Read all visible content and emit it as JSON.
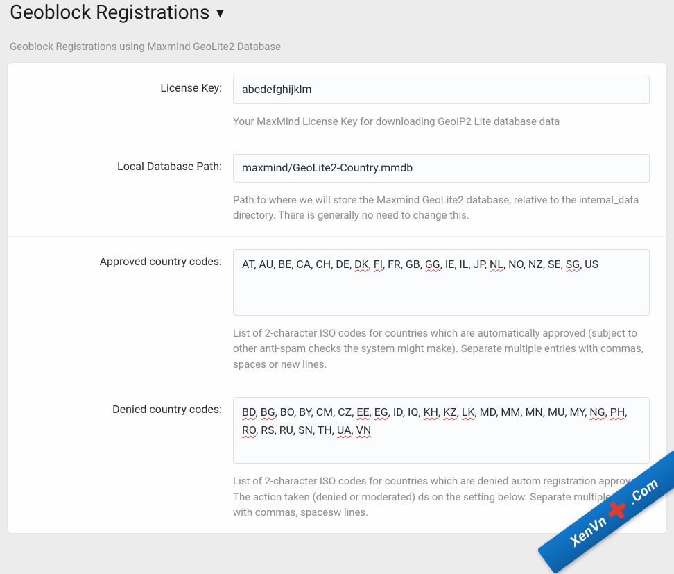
{
  "header": {
    "title": "Geoblock Registrations",
    "subtitle": "Geoblock Registrations using Maxmind GeoLite2 Database"
  },
  "fields": {
    "license": {
      "label": "License Key:",
      "value": "abcdefghijklm",
      "help": "Your MaxMind License Key for downloading GeoIP2 Lite database data"
    },
    "dbpath": {
      "label": "Local Database Path:",
      "value": "maxmind/GeoLite2-Country.mmdb",
      "help": "Path to where we will store the Maxmind GeoLite2 database, relative to the internal_data directory. There is generally no need to change this."
    },
    "approved": {
      "label": "Approved country codes:",
      "codes": [
        {
          "t": "AT"
        },
        {
          "t": "AU"
        },
        {
          "t": "BE"
        },
        {
          "t": "CA"
        },
        {
          "t": "CH"
        },
        {
          "t": "DE"
        },
        {
          "t": "DK",
          "sp": true
        },
        {
          "t": "FI",
          "sp": true
        },
        {
          "t": "FR"
        },
        {
          "t": "GB"
        },
        {
          "t": "GG",
          "sp": true
        },
        {
          "t": "IE"
        },
        {
          "t": "IL"
        },
        {
          "t": "JP"
        },
        {
          "t": "NL",
          "sp": true
        },
        {
          "t": "NO"
        },
        {
          "t": "NZ"
        },
        {
          "t": "SE"
        },
        {
          "t": "SG",
          "sp": true
        },
        {
          "t": "US"
        }
      ],
      "help": "List of 2-character ISO codes for countries which are automatically approved (subject to other anti-spam checks the system might make). Separate multiple entries with commas, spaces or new lines."
    },
    "denied": {
      "label": "Denied country codes:",
      "codes": [
        {
          "t": "BD",
          "sp": true
        },
        {
          "t": "BG",
          "sp": true
        },
        {
          "t": "BO"
        },
        {
          "t": "BY"
        },
        {
          "t": "CM"
        },
        {
          "t": "CZ"
        },
        {
          "t": "EE",
          "sp": true
        },
        {
          "t": "EG",
          "sp": true
        },
        {
          "t": "ID"
        },
        {
          "t": "IQ"
        },
        {
          "t": "KH",
          "sp": true
        },
        {
          "t": "KZ",
          "sp": true
        },
        {
          "t": "LK",
          "sp": true
        },
        {
          "t": "MD"
        },
        {
          "t": "MM"
        },
        {
          "t": " MN"
        },
        {
          "t": "MU"
        },
        {
          "t": "MY"
        },
        {
          "t": "NG",
          "sp": true
        },
        {
          "t": "PH",
          "sp": true
        },
        {
          "t": "RO",
          "sp": true
        },
        {
          "t": "RS"
        },
        {
          "t": "RU"
        },
        {
          "t": "SN"
        },
        {
          "t": "TH"
        },
        {
          "t": "UA",
          "sp": true
        },
        {
          "t": "VN",
          "sp": true
        }
      ],
      "help_parts": [
        "List of 2-character ISO codes for countries which are denied autom",
        " registration approval. The action taken (denied or moderated) d",
        "s on the setting below. Separate multiple entries with commas, spaces",
        "w lines."
      ]
    }
  },
  "watermark": {
    "text_a": "XenVn",
    "text_b": ".Com"
  }
}
